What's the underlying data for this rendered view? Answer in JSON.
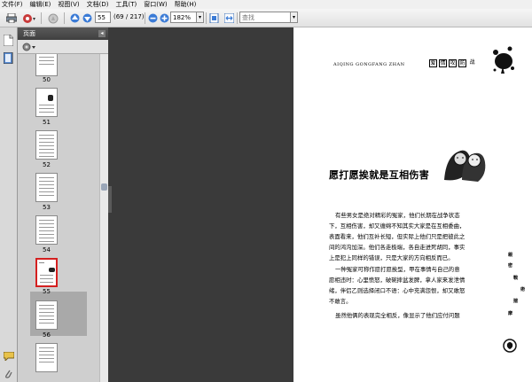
{
  "menubar": [
    {
      "label": "文件(F)"
    },
    {
      "label": "编辑(E)"
    },
    {
      "label": "视图(V)"
    },
    {
      "label": "文档(D)"
    },
    {
      "label": "工具(T)"
    },
    {
      "label": "窗口(W)"
    },
    {
      "label": "帮助(H)"
    }
  ],
  "toolbar": {
    "page_value": "55",
    "page_count": "(69 / 217)",
    "zoom_value": "182%",
    "search_placeholder": "查找"
  },
  "nav_panel": {
    "title": "页面",
    "thumbnails": [
      {
        "label": "50"
      },
      {
        "label": "51"
      },
      {
        "label": "52"
      },
      {
        "label": "53"
      },
      {
        "label": "54"
      },
      {
        "label": "55"
      },
      {
        "label": "56"
      }
    ],
    "selected_page": "55"
  },
  "document": {
    "header_latin": "AIQING GONGFANG ZHAN",
    "header_boxes": [
      "爱",
      "情",
      "攻",
      "防",
      "战"
    ],
    "title": "愿打愿挨就是互相伤害",
    "paragraphs": [
      "有些男女是绝对精彩的冤家，他们长期在战争状态",
      "下，互相伤害，却又缠绵不知其实大家是在互相委曲，",
      "表面看来，他们互补长短，但实际上他们只是把彼此之",
      "间的鸿沟加深。他们各走极端，各自走进死胡同，事实",
      "上是犯上同样的错误，只是大家的方向相反而已。",
      "一种冤家可称作愿打愿挨型，甲在事情与自己的意",
      "愿相违时：心里愤怒，破碗摔盆发脾，拿人家来发泄情",
      "绪，伴侣乙则选择闭口不语：心中充满怨恨，却又敢怒",
      "不敢言。",
      "虽然他俩的表现完全相反，像显示了他们应付问题"
    ],
    "side_vertical": [
      "親",
      "密",
      "戰",
      "術",
      "揣",
      "摩"
    ]
  }
}
